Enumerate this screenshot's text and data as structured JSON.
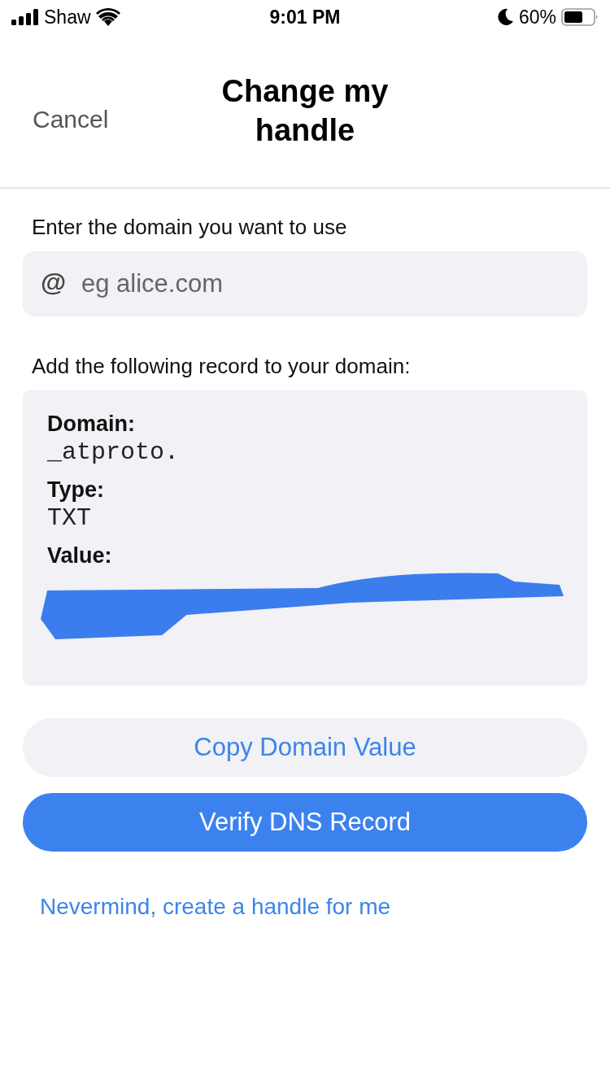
{
  "status_bar": {
    "carrier": "Shaw",
    "time": "9:01 PM",
    "battery": "60%"
  },
  "header": {
    "cancel": "Cancel",
    "title": "Change my handle"
  },
  "domain_field": {
    "label": "Enter the domain you want to use",
    "prefix": "@",
    "placeholder": "eg alice.com"
  },
  "record": {
    "intro": "Add the following record to your domain:",
    "fields": [
      {
        "label": "Domain:",
        "value": "_atproto."
      },
      {
        "label": "Type:",
        "value": "TXT"
      },
      {
        "label": "Value:",
        "redacted": true
      }
    ]
  },
  "buttons": [
    {
      "label": "Copy Domain Value",
      "kind": "secondary"
    },
    {
      "label": "Verify DNS Record",
      "kind": "primary"
    }
  ],
  "link": "Nevermind, create a handle for me"
}
